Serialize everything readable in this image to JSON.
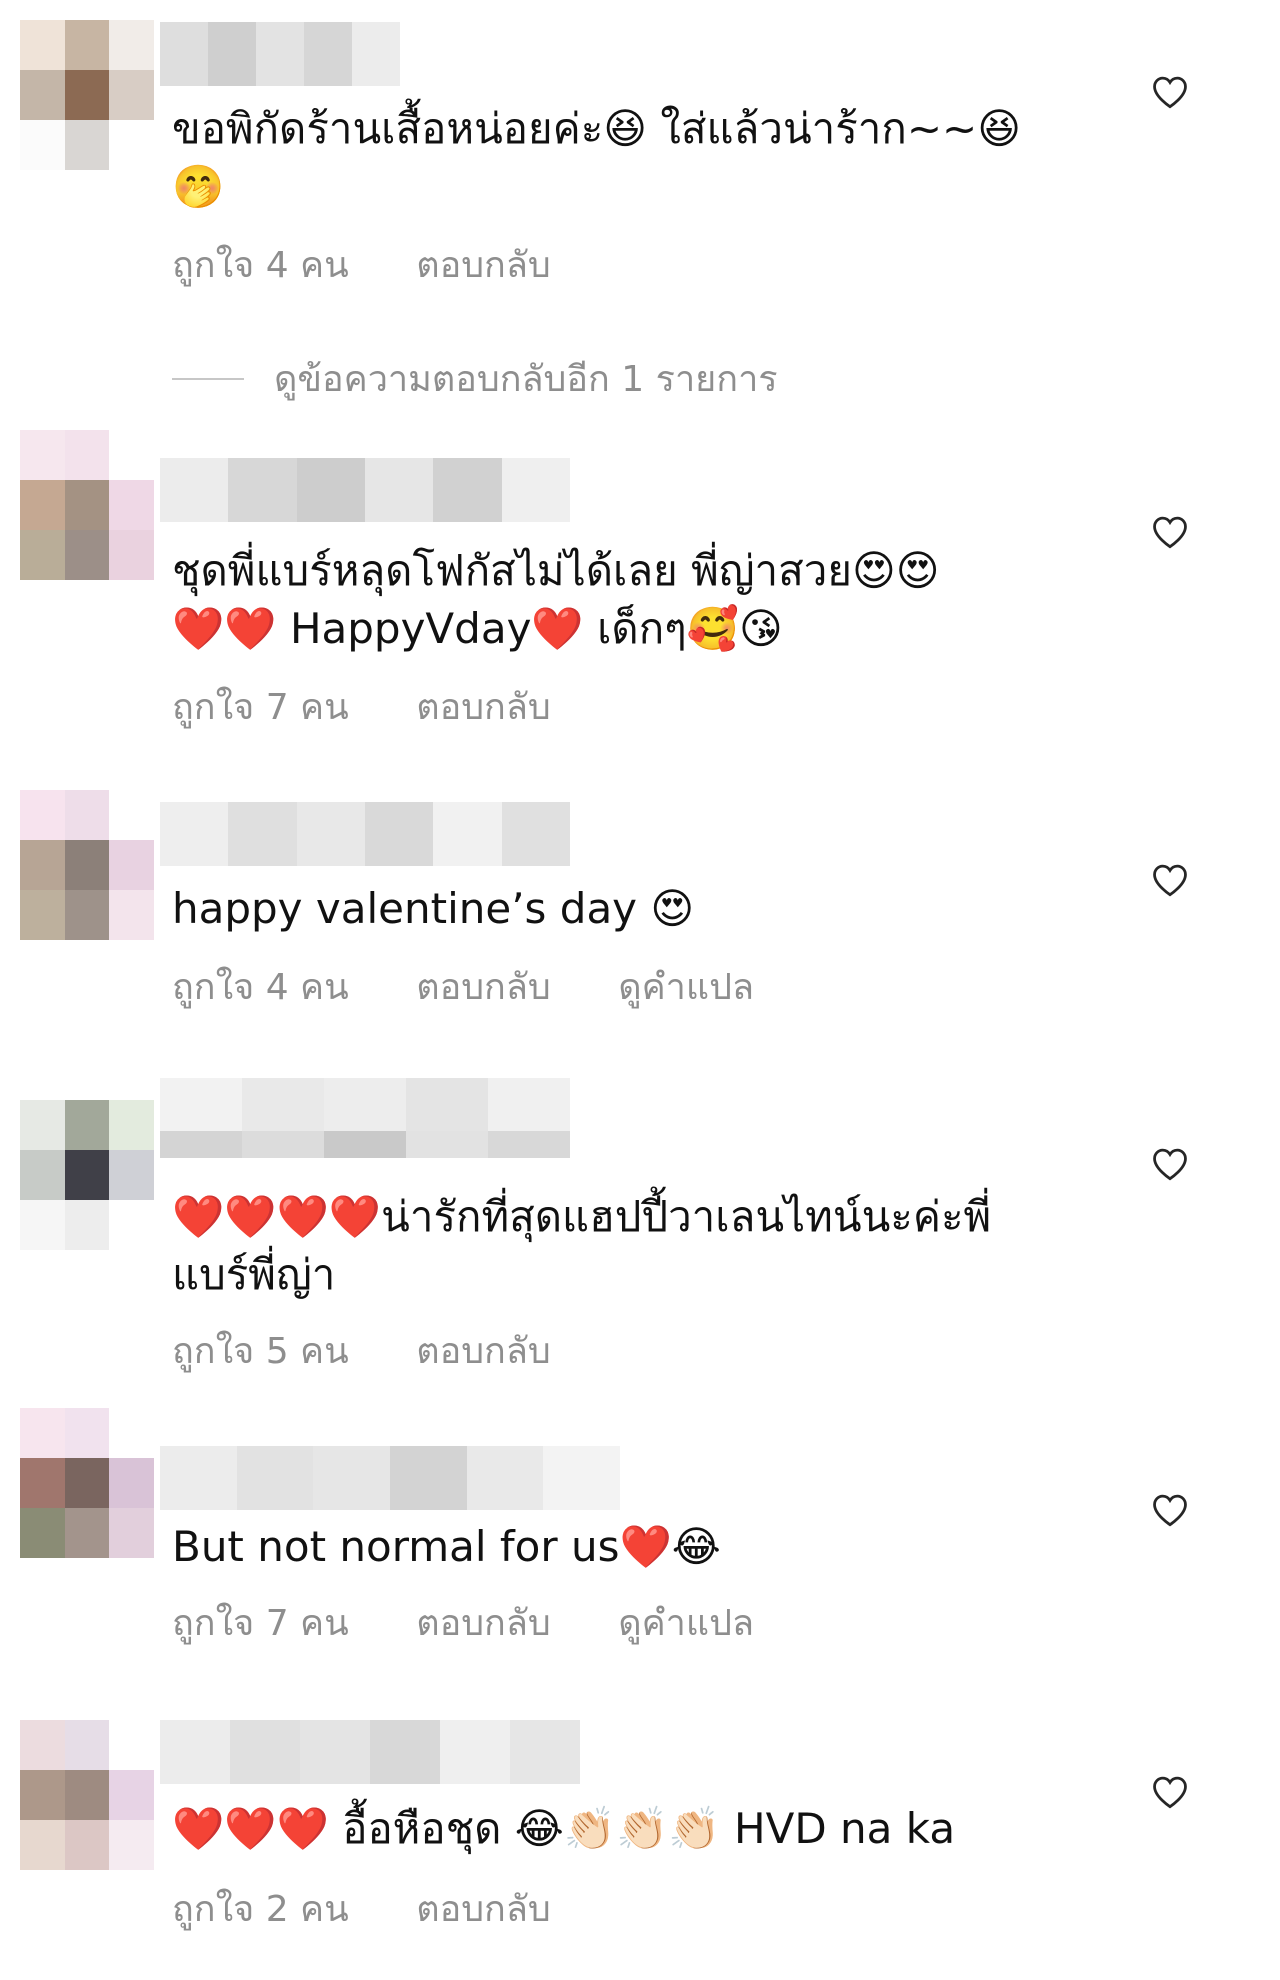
{
  "comments": [
    {
      "text_line1": "ขอพิกัดร้านเสื้อหน่อยค่ะ😆 ใส่แล้วน่าร้าก~~😆",
      "text_line2": "🤭",
      "likes": "ถูกใจ 4 คน",
      "reply": "ตอบกลับ"
    },
    {
      "text_line1": "ชุดพี่แบร์หลุดโฟกัสไม่ได้เลย  พี่ญ่าสวย😍😍",
      "text_line2": "❤️❤️ HappyVday❤️ เด็กๆ🥰😘",
      "likes": "ถูกใจ 7 คน",
      "reply": "ตอบกลับ"
    },
    {
      "text_line1": "happy valentine’s day 😍",
      "likes": "ถูกใจ 4 คน",
      "reply": "ตอบกลับ",
      "translate": "ดูคำแปล"
    },
    {
      "text_line1": "❤️❤️❤️❤️น่ารักที่สุดแฮปปี้วาเลนไทน์นะค่ะพี่",
      "text_line2": "แบร์พี่ญ่า",
      "likes": "ถูกใจ 5 คน",
      "reply": "ตอบกลับ"
    },
    {
      "text_line1": "But not normal for us❤️😂",
      "likes": "ถูกใจ 7 คน",
      "reply": "ตอบกลับ",
      "translate": "ดูคำแปล"
    },
    {
      "text_line1": "❤️❤️❤️ อื้อหือชุด 😂👏🏻👏🏻👏🏻 HVD na ka",
      "likes": "ถูกใจ 2 คน",
      "reply": "ตอบกลับ"
    }
  ],
  "view_replies": "ดูข้อความตอบกลับอีก 1 รายการ",
  "icons": {
    "like": "heart-outline-icon"
  },
  "colors": {
    "meta_text": "#8e8e8e",
    "body_text": "#111111",
    "heart_outline": "#262626",
    "red_heart": "#e0182d"
  }
}
